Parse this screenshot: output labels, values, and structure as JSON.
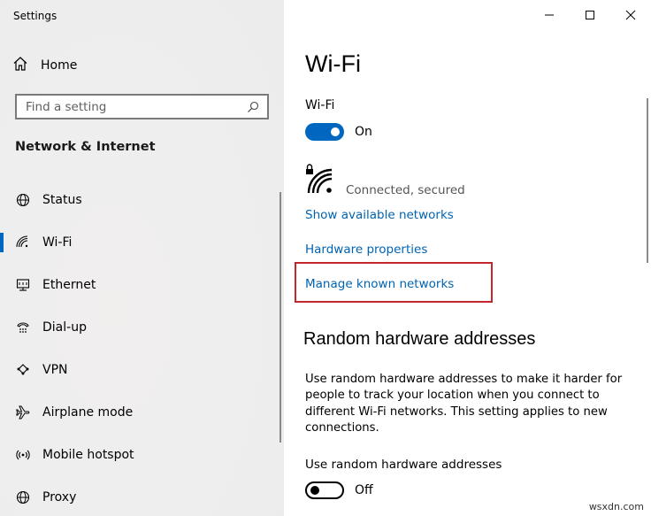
{
  "window": {
    "title": "Settings"
  },
  "sidebar": {
    "home_label": "Home",
    "search_placeholder": "Find a setting",
    "section_title": "Network & Internet",
    "items": [
      {
        "label": "Status",
        "icon": "globe-icon",
        "active": false
      },
      {
        "label": "Wi-Fi",
        "icon": "wifi-icon",
        "active": true
      },
      {
        "label": "Ethernet",
        "icon": "ethernet-icon",
        "active": false
      },
      {
        "label": "Dial-up",
        "icon": "dialup-icon",
        "active": false
      },
      {
        "label": "VPN",
        "icon": "vpn-icon",
        "active": false
      },
      {
        "label": "Airplane mode",
        "icon": "airplane-icon",
        "active": false
      },
      {
        "label": "Mobile hotspot",
        "icon": "hotspot-icon",
        "active": false
      },
      {
        "label": "Proxy",
        "icon": "proxy-icon",
        "active": false
      }
    ]
  },
  "main": {
    "title": "Wi-Fi",
    "wifi_label": "Wi-Fi",
    "wifi_toggle_state": "On",
    "network_status": "Connected, secured",
    "links": {
      "show_networks": "Show available networks",
      "hardware_properties": "Hardware properties",
      "manage_known": "Manage known networks"
    },
    "random_hw": {
      "title": "Random hardware addresses",
      "description": "Use random hardware addresses to make it harder for people to track your location when you connect to different Wi-Fi networks. This setting applies to new connections.",
      "setting_label": "Use random hardware addresses",
      "toggle_state": "Off"
    }
  },
  "colors": {
    "accent": "#0067c0",
    "link": "#0063b1",
    "highlight": "#c4262e",
    "sidebar_bg": "#eeeeee"
  },
  "watermark": "wsxdn.com"
}
